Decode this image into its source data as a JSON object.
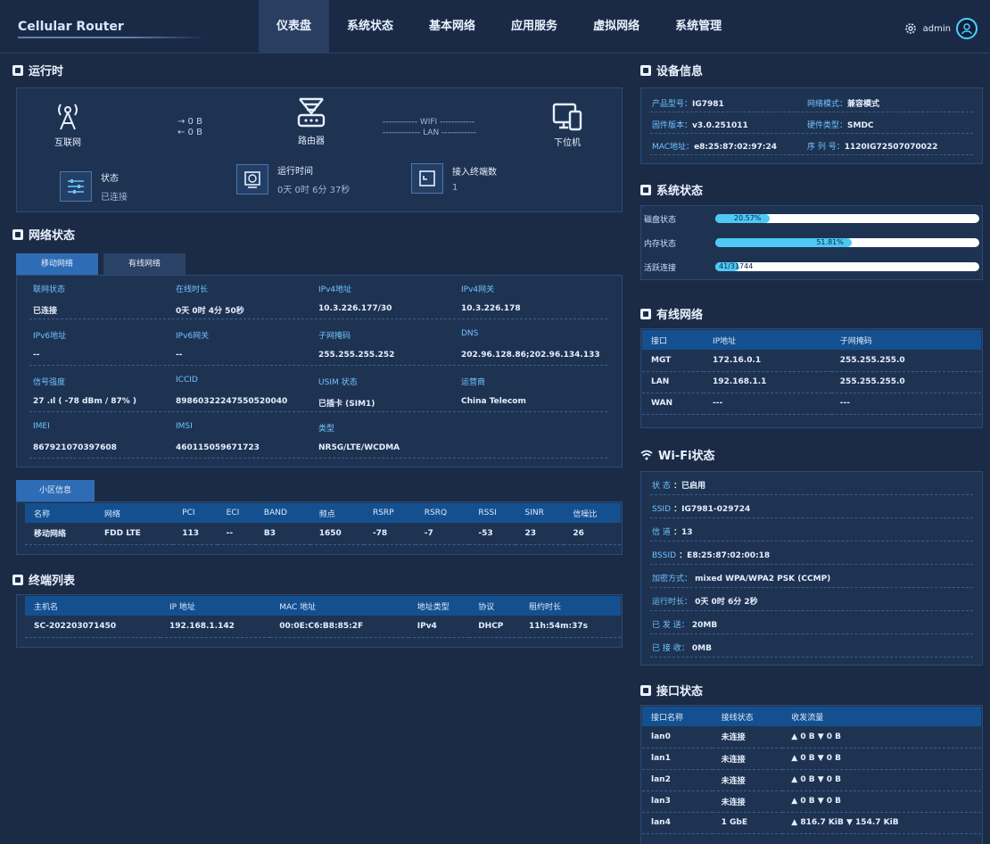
{
  "app": {
    "brand": "Cellular Router",
    "user": "admin"
  },
  "nav": [
    "仪表盘",
    "系统状态",
    "基本网络",
    "应用服务",
    "虚拟网络",
    "系统管理"
  ],
  "runtime": {
    "title": "运行时",
    "internet": "互联网",
    "router": "路由器",
    "client": "下位机",
    "tx": "→ 0 B",
    "rx": "← 0 B",
    "wifi": "------------ WIFI ------------",
    "lan": "------------- LAN ------------",
    "status_label": "状态",
    "status_value": "已连接",
    "uptime_label": "运行时间",
    "uptime_value": "0天 0时 6分 37秒",
    "terminals_label": "接入终端数",
    "terminals_value": "1"
  },
  "network": {
    "title": "网络状态",
    "tabs": [
      "移动网络",
      "有线网络"
    ],
    "rows": [
      [
        [
          "联网状态",
          "已连接"
        ],
        [
          "在线时长",
          "0天 0时 4分 50秒"
        ],
        [
          "IPv4地址",
          "10.3.226.177/30"
        ],
        [
          "IPv4网关",
          "10.3.226.178"
        ]
      ],
      [
        [
          "IPv6地址",
          "--"
        ],
        [
          "IPv6网关",
          "--"
        ],
        [
          "子网掩码",
          "255.255.255.252"
        ],
        [
          "DNS",
          "202.96.128.86;202.96.134.133"
        ]
      ],
      [
        [
          "信号强度",
          "27 .ıl ( -78 dBm / 87% )"
        ],
        [
          "ICCID",
          "89860322247550520040"
        ],
        [
          "USIM 状态",
          "已插卡 (SIM1)"
        ],
        [
          "运营商",
          "China Telecom"
        ]
      ],
      [
        [
          "IMEI",
          "867921070397608"
        ],
        [
          "IMSI",
          "460115059671723"
        ],
        [
          "类型",
          "NR5G/LTE/WCDMA"
        ],
        [
          "",
          ""
        ]
      ]
    ]
  },
  "cell": {
    "tab": "小区信息",
    "headers": [
      "名称",
      "网络",
      "PCI",
      "ECI",
      "BAND",
      "频点",
      "RSRP",
      "RSRQ",
      "RSSI",
      "SINR",
      "信噪比"
    ],
    "row": [
      "移动网络",
      "FDD LTE",
      "113",
      "--",
      "B3",
      "1650",
      "-78",
      "-7",
      "-53",
      "23",
      "26"
    ]
  },
  "terminals": {
    "title": "终端列表",
    "headers": [
      "主机名",
      "IP 地址",
      "MAC 地址",
      "地址类型",
      "协议",
      "租约时长"
    ],
    "row": [
      "SC-202203071450",
      "192.168.1.142",
      "00:0E:C6:B8:85:2F",
      "IPv4",
      "DHCP",
      "11h:54m:37s"
    ]
  },
  "device": {
    "title": "设备信息",
    "rows": [
      [
        [
          "产品型号：",
          "IG7981"
        ],
        [
          "网络模式：",
          "兼容模式"
        ]
      ],
      [
        [
          "固件版本：",
          "v3.0.251011"
        ],
        [
          "硬件类型：",
          "SMDC"
        ]
      ],
      [
        [
          "MAC地址：",
          "e8:25:87:02:97:24"
        ],
        [
          "序 列 号：",
          "1120IG72507070022"
        ]
      ]
    ]
  },
  "sysstatus": {
    "title": "系统状态",
    "bars": [
      {
        "label": "磁盘状态",
        "text": "20.57%",
        "fraction": 0.2057
      },
      {
        "label": "内存状态",
        "text": "51.81%",
        "fraction": 0.5181
      },
      {
        "label": "活跃连接",
        "text": "41/31744",
        "fraction": 0.0013
      }
    ]
  },
  "wired": {
    "title": "有线网络",
    "headers": [
      "接口",
      "IP地址",
      "子网掩码"
    ],
    "rows": [
      [
        "MGT",
        "172.16.0.1",
        "255.255.255.0"
      ],
      [
        "LAN",
        "192.168.1.1",
        "255.255.255.0"
      ],
      [
        "WAN",
        "---",
        "---"
      ]
    ]
  },
  "wifi": {
    "title": "Wi-Fi状态",
    "rows": [
      [
        "状  态",
        "：已启用"
      ],
      [
        "SSID",
        "：IG7981-029724"
      ],
      [
        "信  道",
        "：13"
      ],
      [
        "BSSID",
        "：E8:25:87:02:00:18"
      ],
      [
        "加密方式：",
        "mixed WPA/WPA2 PSK (CCMP)"
      ],
      [
        "运行时长：",
        "0天 0时 6分 2秒"
      ],
      [
        "已 发 送：",
        "20MB"
      ],
      [
        "已 接 收：",
        "0MB"
      ]
    ]
  },
  "ports": {
    "title": "接口状态",
    "headers": [
      "接口名称",
      "接线状态",
      "收发流量"
    ],
    "rows": [
      [
        "lan0",
        "未连接",
        "▲ 0 B ▼ 0 B"
      ],
      [
        "lan1",
        "未连接",
        "▲ 0 B ▼ 0 B"
      ],
      [
        "lan2",
        "未连接",
        "▲ 0 B ▼ 0 B"
      ],
      [
        "lan3",
        "未连接",
        "▲ 0 B ▼ 0 B"
      ],
      [
        "lan4",
        "1 GbE",
        "▲ 816.7 KiB ▼ 154.7 KiB"
      ]
    ]
  }
}
